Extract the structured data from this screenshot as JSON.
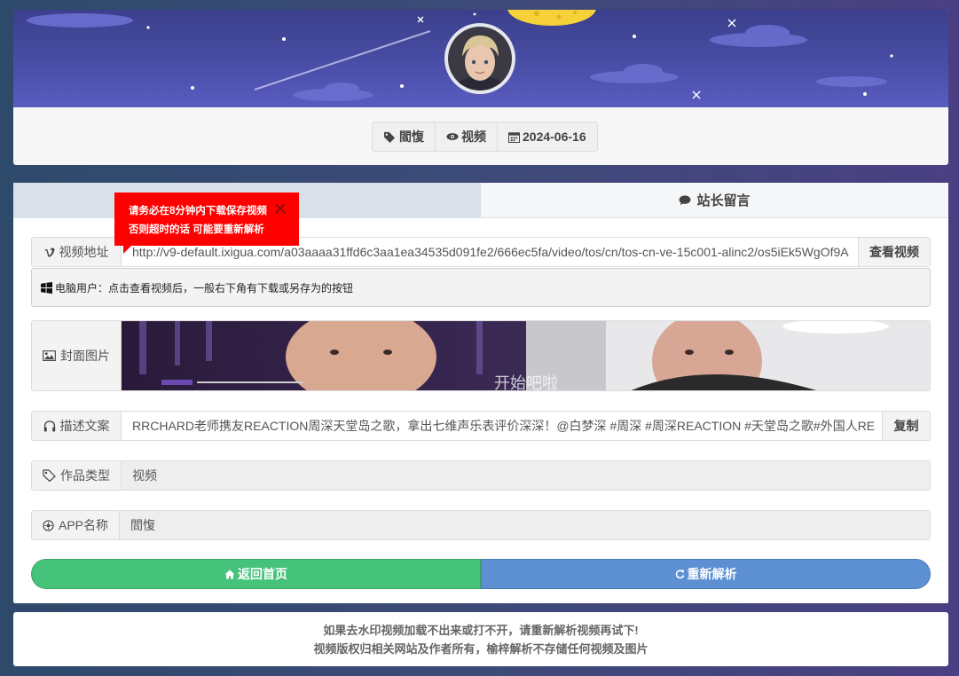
{
  "header": {
    "meta": [
      {
        "icon": "tags-icon",
        "label": "閻愎"
      },
      {
        "icon": "eye-icon",
        "label": "视频"
      },
      {
        "icon": "calendar-icon",
        "label": "2024-06-16"
      }
    ]
  },
  "tabs": {
    "left_label": "",
    "right_label": "站长留言",
    "right_icon": "comments-icon"
  },
  "tooltip": {
    "line1": "请务必在8分钟内下载保存视频",
    "line2": "否则超时的话 可能要重新解析"
  },
  "video_row": {
    "label": "视频地址",
    "value": "http://v9-default.ixigua.com/a03aaaa31ffd6c3aa1ea34535d091fe2/666ec5fa/video/tos/cn/tos-cn-ve-15c001-alinc2/os5iEk5WgOf9A",
    "button": "查看视频"
  },
  "notice": {
    "text": "电脑用户：点击查看视频后，一般右下角有下载或另存为的按钮"
  },
  "cover_row": {
    "label": "封面图片",
    "caption": "开始吧啦"
  },
  "desc_row": {
    "label": "描述文案",
    "value": "RRCHARD老师携友REACTION周深天堂岛之歌，拿出七维声乐表评价深深！@白梦深 #周深 #周深REACTION #天堂岛之歌#外国人RE",
    "button": "复制"
  },
  "type_row": {
    "label": "作品类型",
    "value": "视频"
  },
  "app_row": {
    "label": "APP名称",
    "value": "閻愎"
  },
  "buttons": {
    "home": "返回首页",
    "reparse": "重新解析"
  },
  "footer": {
    "line1": "如果去水印视频加载不出来或打不开，请重新解析视频再试下!",
    "line2": "视频版权归相关网站及作者所有，榆梓解析不存储任何视频及图片"
  },
  "colors": {
    "green": "#46c37b",
    "blue": "#5c90d2",
    "tooltip_red": "#ff0000"
  }
}
